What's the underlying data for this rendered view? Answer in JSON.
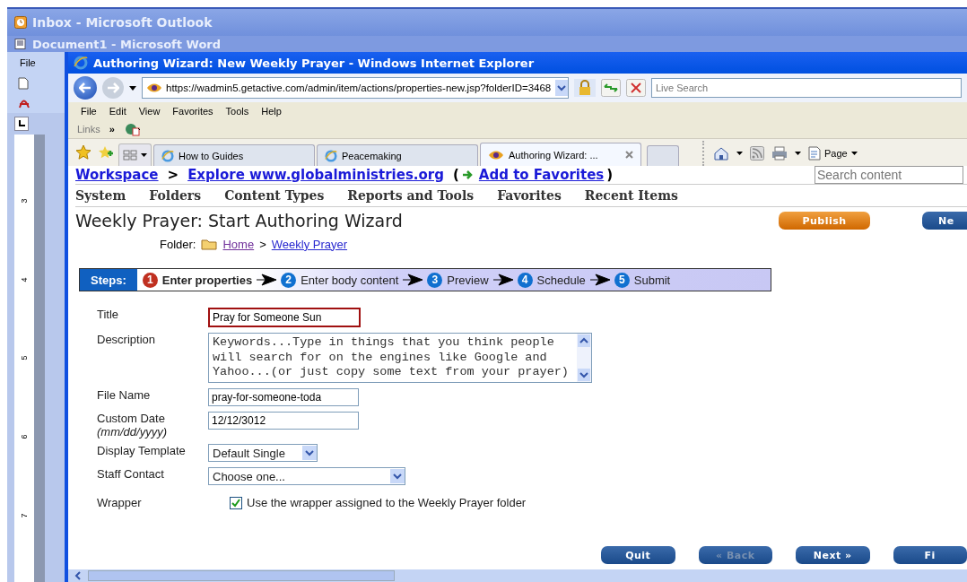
{
  "background_windows": [
    {
      "title": "Inbox - Microsoft Outlook",
      "kind": "outlook"
    },
    {
      "title": "Document1 - Microsoft Word",
      "kind": "word"
    }
  ],
  "word": {
    "menu": "File",
    "ruler_marks": [
      "3",
      "4",
      "5",
      "6",
      "7"
    ]
  },
  "browser": {
    "title": "Authoring Wizard: New Weekly Prayer - Windows Internet Explorer",
    "address": "https://wadmin5.getactive.com/admin/item/actions/properties-new.jsp?folderID=3468",
    "search": {
      "placeholder": "Live Search"
    },
    "menu": [
      "File",
      "Edit",
      "View",
      "Favorites",
      "Tools",
      "Help"
    ],
    "links_label": "Links",
    "links_chevron": "»",
    "tabs": [
      {
        "label": "How to Guides",
        "selected": false,
        "kind": "ie"
      },
      {
        "label": "Peacemaking",
        "selected": false,
        "kind": "ie"
      },
      {
        "label": "Authoring Wizard: ...",
        "selected": true,
        "kind": "site"
      }
    ],
    "page_button": "Page"
  },
  "page": {
    "breadcrumb": [
      {
        "label": "Workspace",
        "kind": "link"
      },
      {
        "label": ">",
        "kind": "separator"
      },
      {
        "label": "Explore www.globalministries.org",
        "kind": "link"
      }
    ],
    "add_favorites": {
      "open": "(",
      "label": "Add to Favorites",
      "close": ")"
    },
    "search": {
      "placeholder": "Search content"
    },
    "nav": [
      "System",
      "Folders",
      "Content Types",
      "Reports and Tools",
      "Favorites",
      "Recent Items"
    ],
    "heading": "Weekly Prayer: Start Authoring Wizard",
    "header_buttons": [
      {
        "label": "Publish",
        "kind": "primary"
      },
      {
        "label": "Ne",
        "kind": "secondary"
      }
    ],
    "folder": {
      "label": "Folder:",
      "path": [
        {
          "label": "Home",
          "visited": true
        },
        {
          "label": "Weekly Prayer",
          "visited": false
        }
      ],
      "separator": ">"
    },
    "steps": {
      "label": "Steps:",
      "items": [
        {
          "number": "1",
          "label": "Enter properties",
          "selected": true
        },
        {
          "number": "2",
          "label": "Enter body content",
          "selected": false
        },
        {
          "number": "3",
          "label": "Preview",
          "selected": false
        },
        {
          "number": "4",
          "label": "Schedule",
          "selected": false
        },
        {
          "number": "5",
          "label": "Submit",
          "selected": false
        }
      ]
    },
    "fields": [
      {
        "label": "Title",
        "kind": "text",
        "value": "Pray for Someone Sun",
        "focused": true
      },
      {
        "label": "Description",
        "kind": "textarea",
        "value": "Keywords...Type in things that you think people will search for on the engines like Google and Yahoo...(or just copy some text from your prayer)",
        "focused": false
      },
      {
        "label": "File Name",
        "kind": "text",
        "value": "pray-for-someone-toda",
        "focused": false
      },
      {
        "label": "Custom Date",
        "hint": "(mm/dd/yyyy)",
        "kind": "text",
        "value": "12/12/3012",
        "focused": false
      },
      {
        "label": "Display Template",
        "kind": "select",
        "value": "Default Single",
        "focused": false
      },
      {
        "label": "Staff Contact",
        "kind": "select-wide",
        "value": "Choose one...",
        "focused": false
      },
      {
        "label": "Wrapper",
        "kind": "checkbox",
        "value": "Use the wrapper assigned to the Weekly Prayer folder",
        "checked": true
      }
    ],
    "buttons": [
      {
        "label": "Quit",
        "disabled": false
      },
      {
        "label": "« Back",
        "disabled": true
      },
      {
        "label": "Next »",
        "disabled": false
      },
      {
        "label": "Fi",
        "disabled": false
      }
    ]
  }
}
